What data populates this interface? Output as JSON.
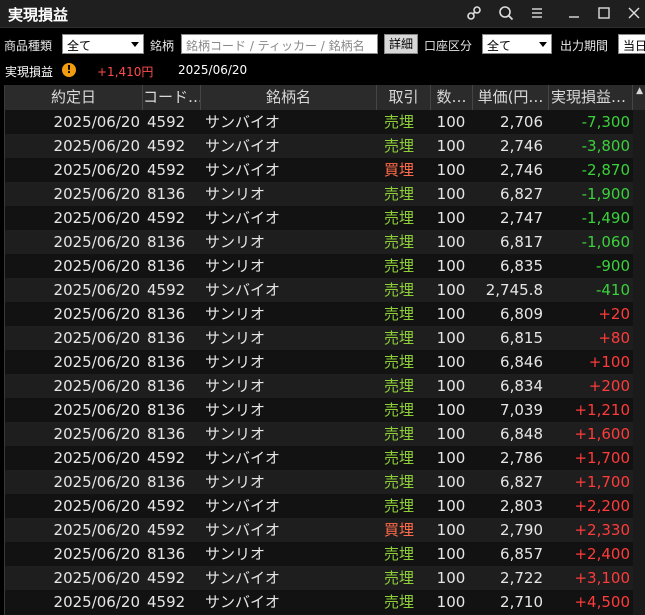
{
  "window": {
    "title": "実現損益",
    "icons": [
      "link-icon",
      "search-icon",
      "menu-icon",
      "minimize-icon",
      "maximize-icon",
      "close-icon"
    ]
  },
  "filters": {
    "product_label": "商品種類",
    "product_value": "全て",
    "brand_label": "銘柄",
    "brand_placeholder": "銘柄コード / ティッカー / 銘柄名",
    "detail_button": "詳細",
    "account_label": "口座区分",
    "account_value": "全て",
    "period_label": "出力期間",
    "period_value": "当日"
  },
  "summary": {
    "label": "実現損益",
    "amount": "+1,410円",
    "date": "2025/06/20"
  },
  "table": {
    "headers": {
      "date": "約定日",
      "code": "コード…",
      "name": "銘柄名",
      "side": "取引",
      "qty": "数…",
      "price": "単価(円…",
      "pl": "実現損益…"
    },
    "rows": [
      {
        "date": "2025/06/20",
        "code": "4592",
        "name": "サンバイオ",
        "side": "売埋",
        "qty": "100",
        "price": "2,706",
        "pl": "-7,300"
      },
      {
        "date": "2025/06/20",
        "code": "4592",
        "name": "サンバイオ",
        "side": "売埋",
        "qty": "100",
        "price": "2,746",
        "pl": "-3,800"
      },
      {
        "date": "2025/06/20",
        "code": "4592",
        "name": "サンバイオ",
        "side": "買埋",
        "qty": "100",
        "price": "2,746",
        "pl": "-2,870"
      },
      {
        "date": "2025/06/20",
        "code": "8136",
        "name": "サンリオ",
        "side": "売埋",
        "qty": "100",
        "price": "6,827",
        "pl": "-1,900"
      },
      {
        "date": "2025/06/20",
        "code": "4592",
        "name": "サンバイオ",
        "side": "売埋",
        "qty": "100",
        "price": "2,747",
        "pl": "-1,490"
      },
      {
        "date": "2025/06/20",
        "code": "8136",
        "name": "サンリオ",
        "side": "売埋",
        "qty": "100",
        "price": "6,817",
        "pl": "-1,060"
      },
      {
        "date": "2025/06/20",
        "code": "8136",
        "name": "サンリオ",
        "side": "売埋",
        "qty": "100",
        "price": "6,835",
        "pl": "-900"
      },
      {
        "date": "2025/06/20",
        "code": "4592",
        "name": "サンバイオ",
        "side": "売埋",
        "qty": "100",
        "price": "2,745.8",
        "pl": "-410"
      },
      {
        "date": "2025/06/20",
        "code": "8136",
        "name": "サンリオ",
        "side": "売埋",
        "qty": "100",
        "price": "6,809",
        "pl": "+20"
      },
      {
        "date": "2025/06/20",
        "code": "8136",
        "name": "サンリオ",
        "side": "売埋",
        "qty": "100",
        "price": "6,815",
        "pl": "+80"
      },
      {
        "date": "2025/06/20",
        "code": "8136",
        "name": "サンリオ",
        "side": "売埋",
        "qty": "100",
        "price": "6,846",
        "pl": "+100"
      },
      {
        "date": "2025/06/20",
        "code": "8136",
        "name": "サンリオ",
        "side": "売埋",
        "qty": "100",
        "price": "6,834",
        "pl": "+200"
      },
      {
        "date": "2025/06/20",
        "code": "8136",
        "name": "サンリオ",
        "side": "売埋",
        "qty": "100",
        "price": "7,039",
        "pl": "+1,210"
      },
      {
        "date": "2025/06/20",
        "code": "8136",
        "name": "サンリオ",
        "side": "売埋",
        "qty": "100",
        "price": "6,848",
        "pl": "+1,600"
      },
      {
        "date": "2025/06/20",
        "code": "4592",
        "name": "サンバイオ",
        "side": "売埋",
        "qty": "100",
        "price": "2,786",
        "pl": "+1,700"
      },
      {
        "date": "2025/06/20",
        "code": "8136",
        "name": "サンリオ",
        "side": "売埋",
        "qty": "100",
        "price": "6,827",
        "pl": "+1,700"
      },
      {
        "date": "2025/06/20",
        "code": "4592",
        "name": "サンバイオ",
        "side": "売埋",
        "qty": "100",
        "price": "2,803",
        "pl": "+2,200"
      },
      {
        "date": "2025/06/20",
        "code": "4592",
        "name": "サンバイオ",
        "side": "買埋",
        "qty": "100",
        "price": "2,790",
        "pl": "+2,330"
      },
      {
        "date": "2025/06/20",
        "code": "8136",
        "name": "サンリオ",
        "side": "売埋",
        "qty": "100",
        "price": "6,857",
        "pl": "+2,400"
      },
      {
        "date": "2025/06/20",
        "code": "4592",
        "name": "サンバイオ",
        "side": "売埋",
        "qty": "100",
        "price": "2,722",
        "pl": "+3,100"
      },
      {
        "date": "2025/06/20",
        "code": "4592",
        "name": "サンバイオ",
        "side": "売埋",
        "qty": "100",
        "price": "2,710",
        "pl": "+4,500"
      }
    ]
  },
  "colors": {
    "sell": "#8fcf3a",
    "buy": "#ff6b4a",
    "loss": "#3ad13a",
    "gain": "#ff3b3b"
  }
}
